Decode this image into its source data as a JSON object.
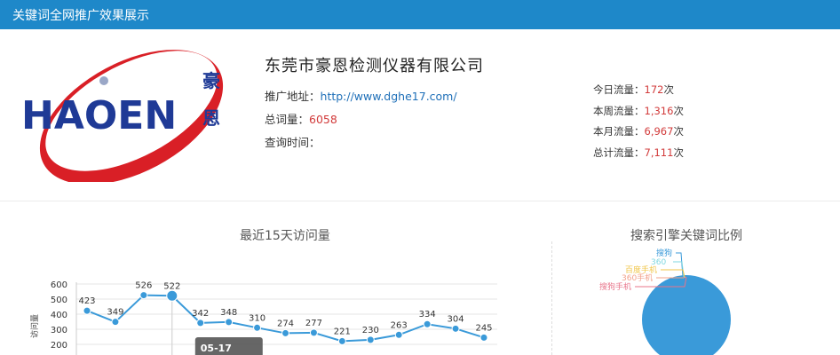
{
  "header": {
    "title": "关键词全网推广效果展示"
  },
  "logo": {
    "text": "HAOEN",
    "cn_text": "豪恩"
  },
  "company": {
    "name": "东莞市豪恩检测仪器有限公司",
    "url_label": "推广地址：",
    "url": "http://www.dghe17.com/",
    "keywords_label": "总词量：",
    "keywords_value": "6058",
    "query_time_label": "查询时间："
  },
  "stats": [
    {
      "label": "今日流量：",
      "value": "172",
      "unit": "次"
    },
    {
      "label": "本周流量：",
      "value": "1,316",
      "unit": "次"
    },
    {
      "label": "本月流量：",
      "value": "6,967",
      "unit": "次"
    },
    {
      "label": "总计流量：",
      "value": "7,111",
      "unit": "次"
    }
  ],
  "colors": {
    "header": "#1e88c9",
    "line": "#3a9ad9",
    "pie": "#3a9ad9",
    "accent_red": "#d23b3b",
    "link": "#1e6fb8"
  },
  "chart_data": [
    {
      "type": "line",
      "title": "最近15天访问量",
      "ylabel": "访问量",
      "ylim": [
        0,
        600
      ],
      "y_ticks": [
        200,
        300,
        400,
        500,
        600
      ],
      "values": [
        423,
        349,
        526,
        522,
        342,
        348,
        310,
        274,
        277,
        221,
        230,
        263,
        334,
        304,
        245
      ],
      "tooltip": {
        "label": "05-17",
        "index": 3
      }
    },
    {
      "type": "pie",
      "title": "搜索引擎关键词比例",
      "labels": [
        {
          "name": "搜狗",
          "color": "#3a9ad9"
        },
        {
          "name": "360",
          "color": "#7fd7e0"
        },
        {
          "name": "百度手机",
          "color": "#f0c64a"
        },
        {
          "name": "360手机",
          "color": "#f2a08a"
        },
        {
          "name": "搜狗手机",
          "color": "#e8748a"
        }
      ]
    }
  ]
}
